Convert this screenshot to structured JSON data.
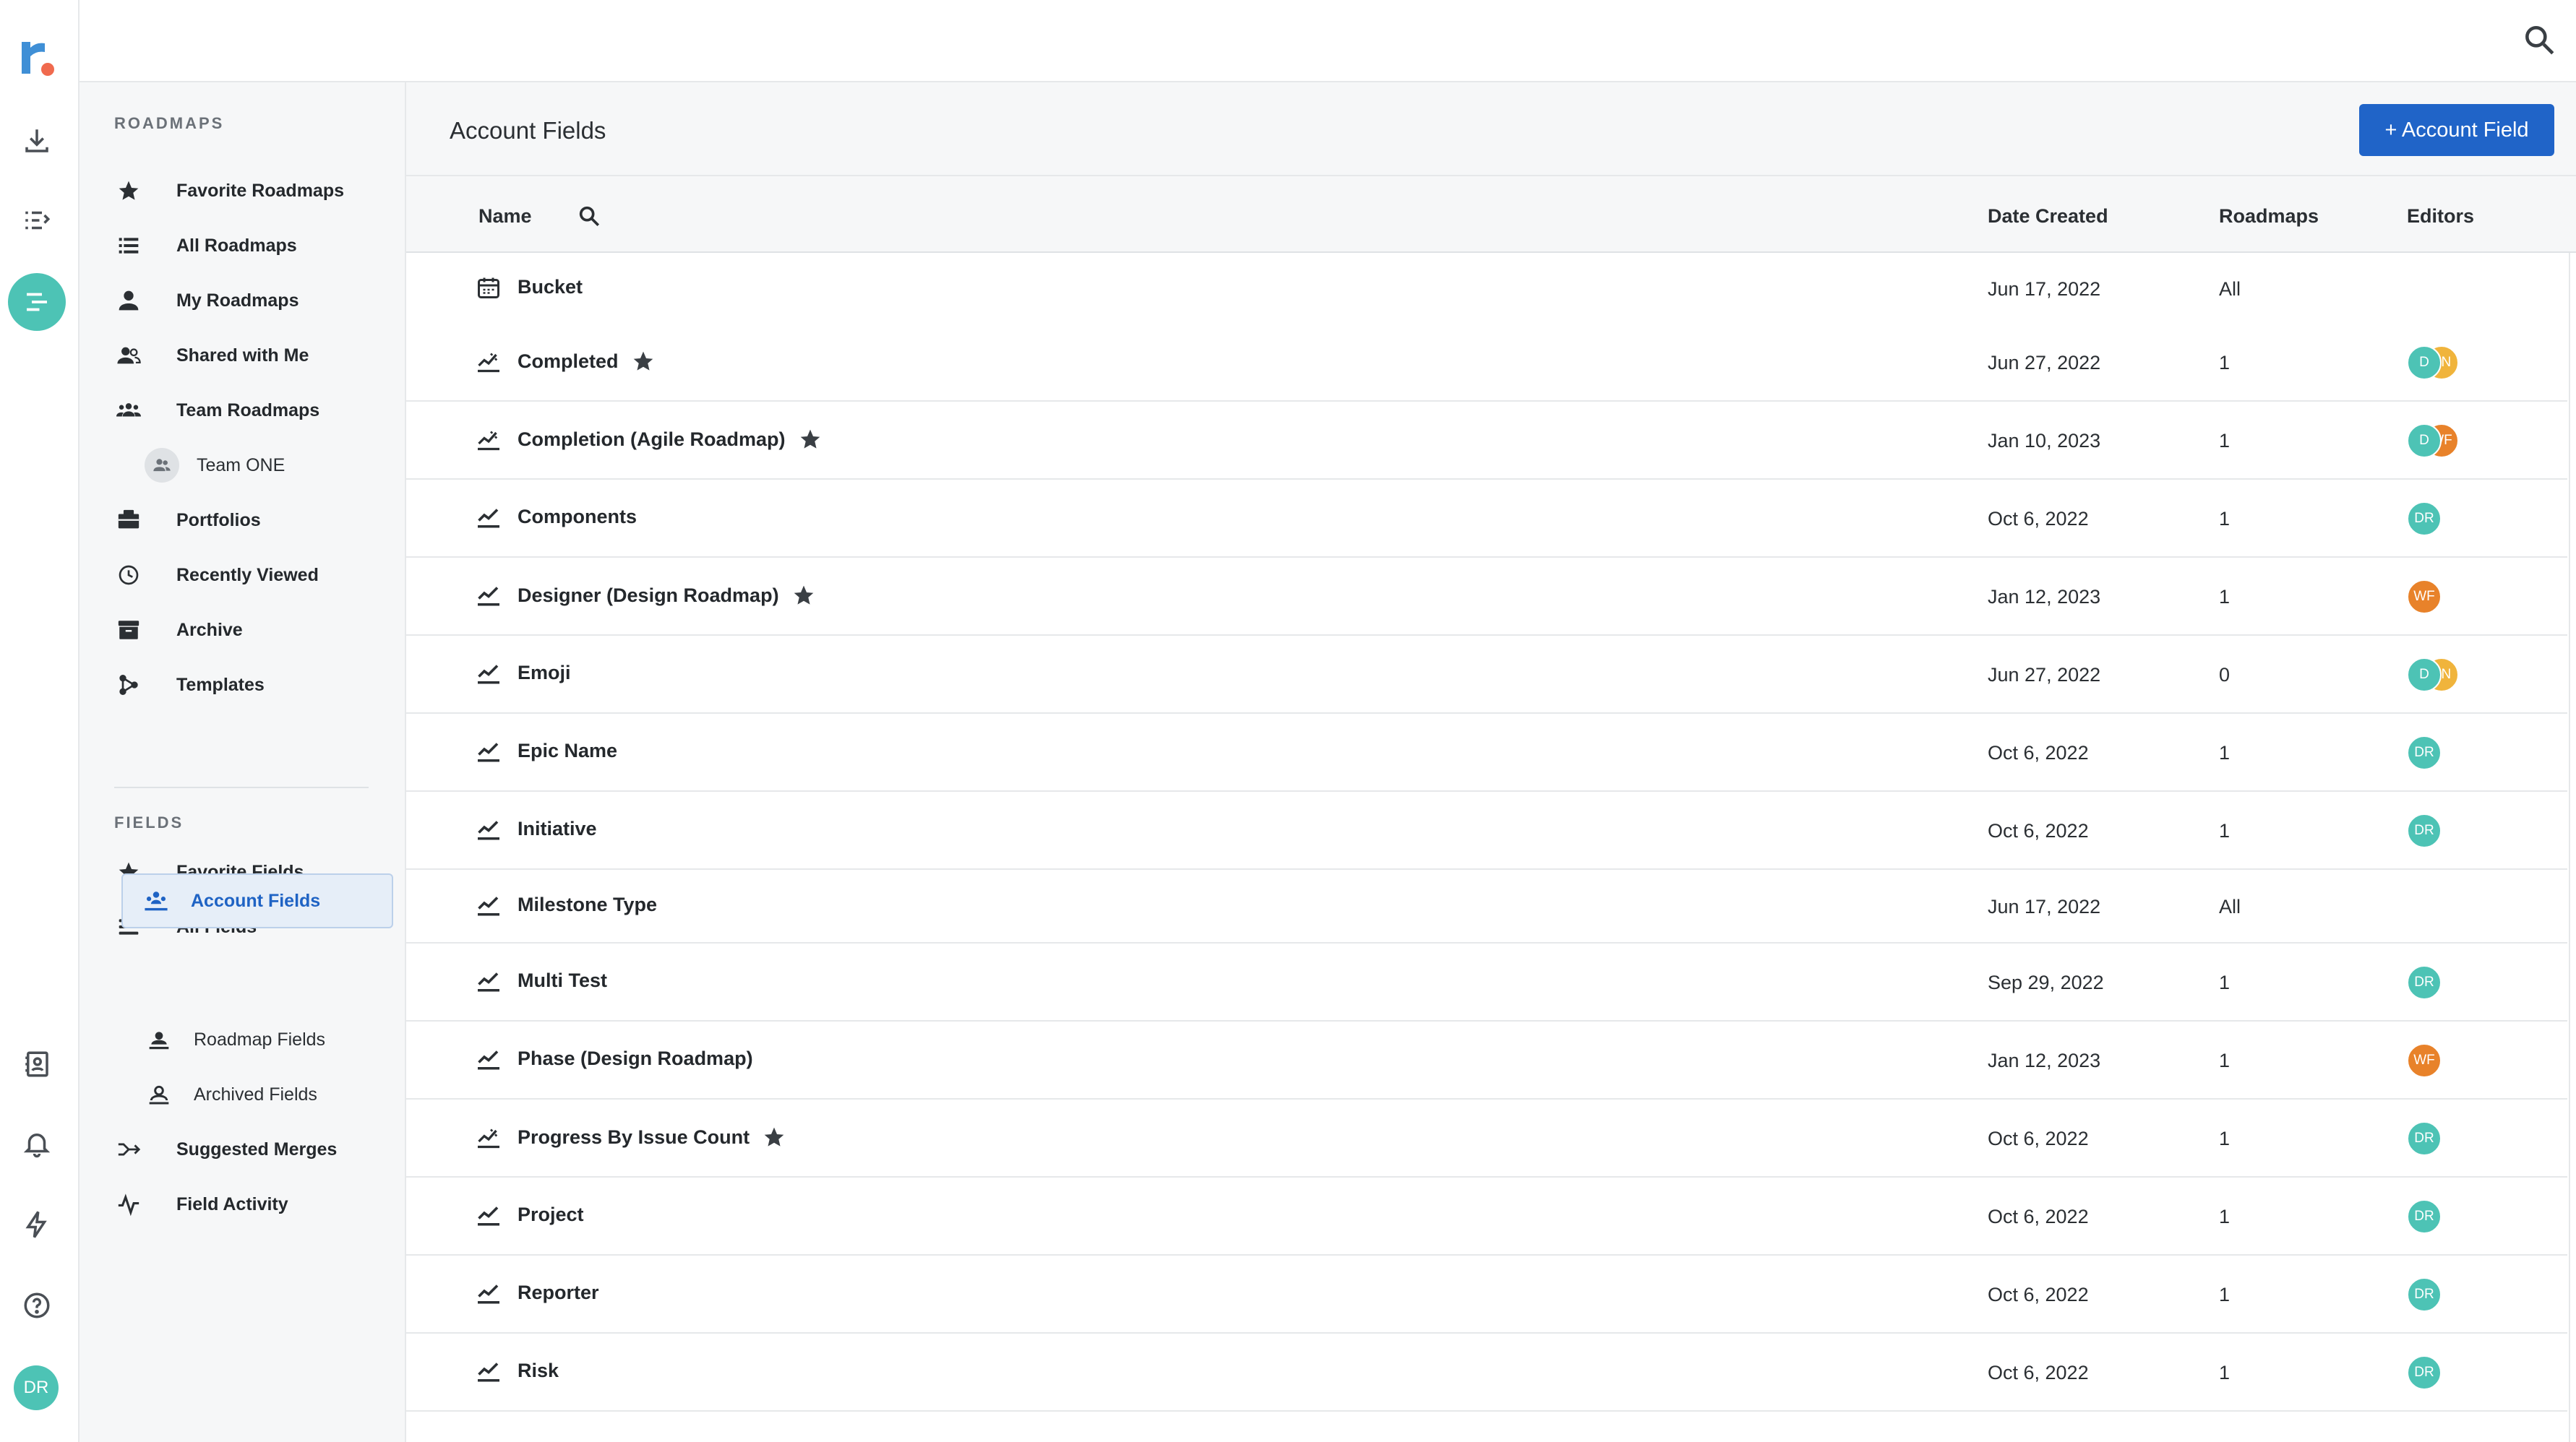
{
  "rail": {
    "avatar_initials": "DR"
  },
  "sidebar": {
    "roadmaps_heading": "ROADMAPS",
    "roadmap_items": [
      {
        "label": "Favorite Roadmaps",
        "icon": "star-icon"
      },
      {
        "label": "All Roadmaps",
        "icon": "list-icon"
      },
      {
        "label": "My Roadmaps",
        "icon": "person-icon"
      },
      {
        "label": "Shared with Me",
        "icon": "shared-people-icon"
      },
      {
        "label": "Team Roadmaps",
        "icon": "team-icon"
      },
      {
        "label": "Team ONE",
        "icon": "team-avatar-icon"
      },
      {
        "label": "Portfolios",
        "icon": "briefcase-icon"
      },
      {
        "label": "Recently Viewed",
        "icon": "clock-icon"
      },
      {
        "label": "Archive",
        "icon": "archive-box-icon"
      },
      {
        "label": "Templates",
        "icon": "templates-icon"
      }
    ],
    "fields_heading": "FIELDS",
    "field_items": [
      {
        "label": "Favorite Fields",
        "icon": "star-icon"
      },
      {
        "label": "All Fields",
        "icon": "stack-lines-icon"
      },
      {
        "label": "Account Fields",
        "icon": "account-people-icon"
      },
      {
        "label": "Roadmap Fields",
        "icon": "person-icon"
      },
      {
        "label": "Archived Fields",
        "icon": "person-outline-icon"
      },
      {
        "label": "Suggested Merges",
        "icon": "merge-arrow-icon"
      },
      {
        "label": "Field Activity",
        "icon": "activity-pulse-icon"
      }
    ]
  },
  "main": {
    "title": "Account Fields",
    "add_button_label": "+ Account Field",
    "columns": {
      "name": "Name",
      "date_created": "Date Created",
      "roadmaps": "Roadmaps",
      "editors": "Editors"
    },
    "rows": [
      {
        "name": "Bucket",
        "icon": "calendar-icon",
        "starred": false,
        "date": "Jun 17, 2022",
        "roadmaps": "All",
        "editors": []
      },
      {
        "name": "Completed",
        "icon": "percent-field-icon",
        "starred": true,
        "date": "Jun 27, 2022",
        "roadmaps": "1",
        "editors": [
          {
            "initials": "D",
            "color": "#4dc3b5"
          },
          {
            "initials": "EN",
            "color": "#f0b43c"
          }
        ]
      },
      {
        "name": "Completion (Agile Roadmap)",
        "icon": "percent-field-icon",
        "starred": true,
        "date": "Jan 10, 2023",
        "roadmaps": "1",
        "editors": [
          {
            "initials": "D",
            "color": "#4dc3b5"
          },
          {
            "initials": "WF",
            "color": "#e8822a"
          }
        ]
      },
      {
        "name": "Components",
        "icon": "check-field-icon",
        "starred": false,
        "date": "Oct 6, 2022",
        "roadmaps": "1",
        "editors": [
          {
            "initials": "DR",
            "color": "#4dc3b5"
          }
        ]
      },
      {
        "name": "Designer (Design Roadmap)",
        "icon": "check-field-icon",
        "starred": true,
        "date": "Jan 12, 2023",
        "roadmaps": "1",
        "editors": [
          {
            "initials": "WF",
            "color": "#e8822a"
          }
        ]
      },
      {
        "name": "Emoji",
        "icon": "check-field-icon",
        "starred": false,
        "date": "Jun 27, 2022",
        "roadmaps": "0",
        "editors": [
          {
            "initials": "D",
            "color": "#4dc3b5"
          },
          {
            "initials": "EN",
            "color": "#f0b43c"
          }
        ]
      },
      {
        "name": "Epic Name",
        "icon": "check-field-icon",
        "starred": false,
        "date": "Oct 6, 2022",
        "roadmaps": "1",
        "editors": [
          {
            "initials": "DR",
            "color": "#4dc3b5"
          }
        ]
      },
      {
        "name": "Initiative",
        "icon": "check-field-icon",
        "starred": false,
        "date": "Oct 6, 2022",
        "roadmaps": "1",
        "editors": [
          {
            "initials": "DR",
            "color": "#4dc3b5"
          }
        ]
      },
      {
        "name": "Milestone Type",
        "icon": "check-field-icon",
        "starred": false,
        "date": "Jun 17, 2022",
        "roadmaps": "All",
        "editors": []
      },
      {
        "name": "Multi Test",
        "icon": "check-field-icon",
        "starred": false,
        "date": "Sep 29, 2022",
        "roadmaps": "1",
        "editors": [
          {
            "initials": "DR",
            "color": "#4dc3b5"
          }
        ]
      },
      {
        "name": "Phase (Design Roadmap)",
        "icon": "check-field-icon",
        "starred": false,
        "date": "Jan 12, 2023",
        "roadmaps": "1",
        "editors": [
          {
            "initials": "WF",
            "color": "#e8822a"
          }
        ]
      },
      {
        "name": "Progress By Issue Count",
        "icon": "percent-field-icon",
        "starred": true,
        "date": "Oct 6, 2022",
        "roadmaps": "1",
        "editors": [
          {
            "initials": "DR",
            "color": "#4dc3b5"
          }
        ]
      },
      {
        "name": "Project",
        "icon": "check-field-icon",
        "starred": false,
        "date": "Oct 6, 2022",
        "roadmaps": "1",
        "editors": [
          {
            "initials": "DR",
            "color": "#4dc3b5"
          }
        ]
      },
      {
        "name": "Reporter",
        "icon": "check-field-icon",
        "starred": false,
        "date": "Oct 6, 2022",
        "roadmaps": "1",
        "editors": [
          {
            "initials": "DR",
            "color": "#4dc3b5"
          }
        ]
      },
      {
        "name": "Risk",
        "icon": "check-field-icon",
        "starred": false,
        "date": "Oct 6, 2022",
        "roadmaps": "1",
        "editors": [
          {
            "initials": "DR",
            "color": "#4dc3b5"
          }
        ]
      }
    ]
  },
  "colors": {
    "accent": "#2064c8",
    "teal": "#4dc3b5",
    "orange": "#e8822a",
    "yellow": "#f0b43c"
  }
}
